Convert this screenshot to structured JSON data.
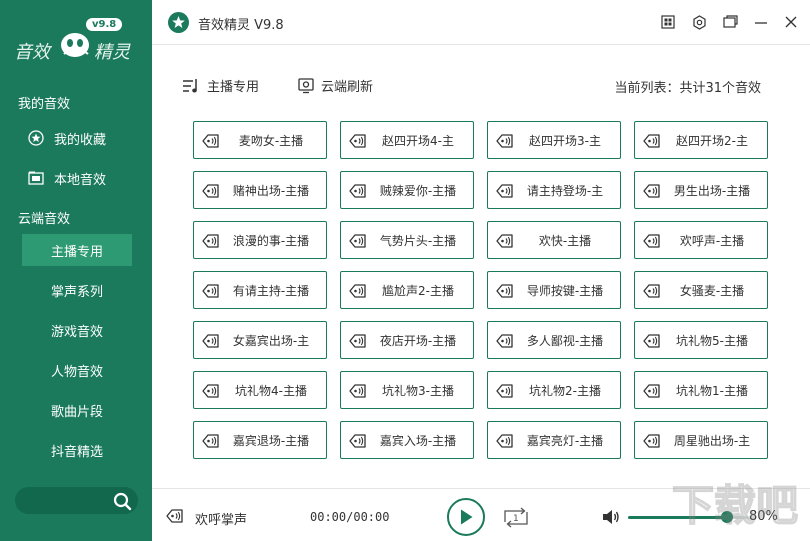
{
  "app": {
    "logo_text_left": "音效",
    "logo_text_right": "精灵",
    "logo_version": "v9.8",
    "title": "音效精灵 V9.8"
  },
  "sidebar": {
    "section_mine": "我的音效",
    "item_favorites": "我的收藏",
    "item_local": "本地音效",
    "section_cloud": "云端音效",
    "cloud_items": [
      "主播专用",
      "掌声系列",
      "游戏音效",
      "人物音效",
      "歌曲片段",
      "抖音精选"
    ],
    "active_index": 0,
    "search_placeholder": ""
  },
  "toolbar": {
    "host_label": "主播专用",
    "refresh_label": "云端刷新",
    "list_info": "当前列表：共计31个音效"
  },
  "sounds": [
    [
      "麦吻女-主播",
      "赵四开场4-主",
      "赵四开场3-主",
      "赵四开场2-主"
    ],
    [
      "赌神出场-主播",
      "贼辣爱你-主播",
      "请主持登场-主",
      "男生出场-主播"
    ],
    [
      "浪漫的事-主播",
      "气势片头-主播",
      "欢快-主播",
      "欢呼声-主播"
    ],
    [
      "有请主持-主播",
      "尴尬声2-主播",
      "导师按键-主播",
      "女骚麦-主播"
    ],
    [
      "女嘉宾出场-主",
      "夜店开场-主播",
      "多人鄙视-主播",
      "坑礼物5-主播"
    ],
    [
      "坑礼物4-主播",
      "坑礼物3-主播",
      "坑礼物2-主播",
      "坑礼物1-主播"
    ],
    [
      "嘉宾退场-主播",
      "嘉宾入场-主播",
      "嘉宾亮灯-主播",
      "周星驰出场-主"
    ]
  ],
  "player": {
    "now_playing": "欢呼掌声",
    "time": "00:00/00:00",
    "volume_fraction": 0.8,
    "volume_label": "80%"
  },
  "colors": {
    "brand": "#1a7a5b",
    "sidebar_active": "#2d9a73"
  },
  "watermark_text": "下载吧"
}
